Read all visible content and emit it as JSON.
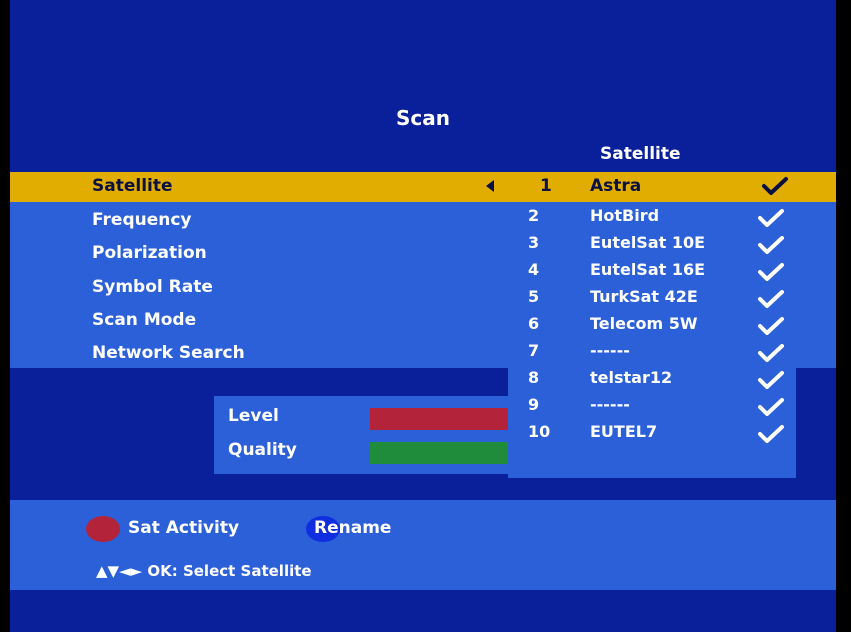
{
  "screen": {
    "title": "Scan"
  },
  "menu": {
    "items": [
      {
        "label": "Satellite"
      },
      {
        "label": "Frequency"
      },
      {
        "label": "Polarization"
      },
      {
        "label": "Symbol Rate"
      },
      {
        "label": "Scan Mode"
      },
      {
        "label": "Network Search"
      }
    ]
  },
  "signal": {
    "level_label": "Level",
    "quality_label": "Quality"
  },
  "satellite_list": {
    "header": "Satellite",
    "selected_number": "1",
    "selected_name": "Astra",
    "rows": [
      {
        "num": "2",
        "name": "HotBird"
      },
      {
        "num": "3",
        "name": "EutelSat 10E"
      },
      {
        "num": "4",
        "name": "EutelSat 16E"
      },
      {
        "num": "5",
        "name": "TurkSat 42E"
      },
      {
        "num": "6",
        "name": "Telecom 5W"
      },
      {
        "num": "7",
        "name": "------"
      },
      {
        "num": "8",
        "name": "telstar12"
      },
      {
        "num": "9",
        "name": "------"
      },
      {
        "num": "10",
        "name": "EUTEL7"
      }
    ]
  },
  "footer": {
    "red_label": "Sat Activity",
    "blue_label": "Rename",
    "hint": "▲▼◄► OK: Select Satellite"
  },
  "colors": {
    "background": "#0a1f9a",
    "panel": "#2c60d8",
    "highlight": "#e0ad00",
    "red_key": "#b3243a",
    "blue_key": "#0f2ee0",
    "green_bar": "#1e8c3a"
  }
}
